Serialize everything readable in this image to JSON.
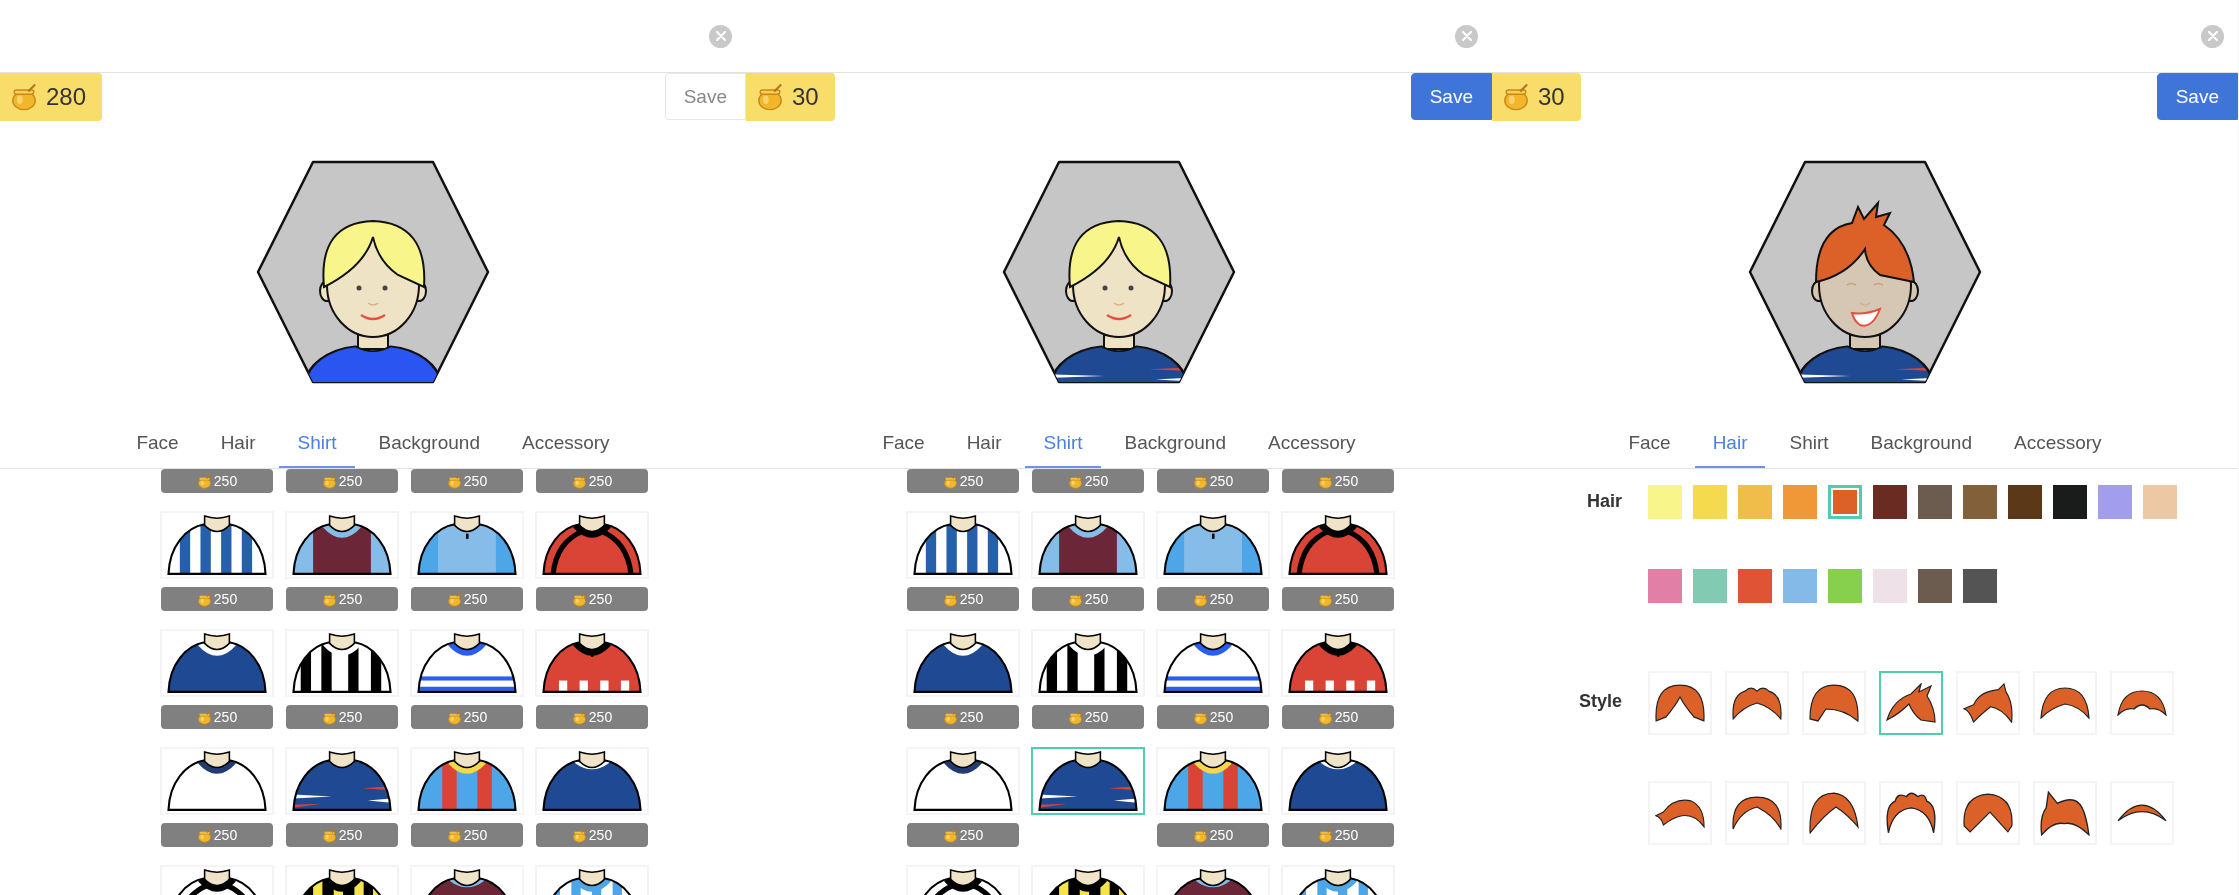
{
  "panels": [
    {
      "coins": "280",
      "save": {
        "label": "Save",
        "disabled": true
      },
      "tabs": [
        {
          "label": "Face",
          "selected": false
        },
        {
          "label": "Hair",
          "selected": false
        },
        {
          "label": "Shirt",
          "selected": true
        },
        {
          "label": "Background",
          "selected": false
        },
        {
          "label": "Accessory",
          "selected": false
        }
      ],
      "kind": "shirts",
      "shirts": [
        {
          "price": "250"
        },
        {
          "price": "250"
        },
        {
          "price": "250"
        },
        {
          "price": "250"
        },
        {
          "price": "250",
          "selected": false
        },
        {
          "price": "250",
          "selected": false
        },
        {
          "price": "250",
          "selected": false
        },
        {
          "price": "250",
          "selected": false
        },
        {
          "price": "250",
          "selected": false
        },
        {
          "price": "250",
          "selected": false
        },
        {
          "price": "250",
          "selected": false
        },
        {
          "price": "250",
          "selected": false
        },
        {
          "price": "250",
          "selected": false
        },
        {
          "price": "250",
          "selected": false
        },
        {
          "price": "250",
          "selected": false
        },
        {
          "price": "250",
          "selected": false
        },
        {
          "selected": false
        },
        {
          "selected": false
        },
        {
          "selected": false
        },
        {
          "selected": false
        }
      ]
    },
    {
      "coins": "30",
      "save": {
        "label": "Save",
        "disabled": false
      },
      "tabs": [
        {
          "label": "Face",
          "selected": false
        },
        {
          "label": "Hair",
          "selected": false
        },
        {
          "label": "Shirt",
          "selected": true
        },
        {
          "label": "Background",
          "selected": false
        },
        {
          "label": "Accessory",
          "selected": false
        }
      ],
      "kind": "shirts",
      "shirts": [
        {
          "price": "250"
        },
        {
          "price": "250"
        },
        {
          "price": "250"
        },
        {
          "price": "250"
        },
        {
          "price": "250",
          "selected": false
        },
        {
          "price": "250",
          "selected": false
        },
        {
          "price": "250",
          "selected": false
        },
        {
          "price": "250",
          "selected": false
        },
        {
          "price": "250",
          "selected": false
        },
        {
          "price": "250",
          "selected": false
        },
        {
          "price": "250",
          "selected": false
        },
        {
          "price": "250",
          "selected": false
        },
        {
          "price": "250",
          "selected": false
        },
        {
          "selected": true
        },
        {
          "price": "250",
          "selected": false
        },
        {
          "price": "250",
          "selected": false
        },
        {
          "selected": false
        },
        {
          "selected": false
        },
        {
          "selected": false
        },
        {
          "selected": false
        }
      ]
    },
    {
      "coins": "30",
      "save": {
        "label": "Save",
        "disabled": false
      },
      "tabs": [
        {
          "label": "Face",
          "selected": false
        },
        {
          "label": "Hair",
          "selected": true
        },
        {
          "label": "Shirt",
          "selected": false
        },
        {
          "label": "Background",
          "selected": false
        },
        {
          "label": "Accessory",
          "selected": false
        }
      ],
      "kind": "hair",
      "hair_label": "Hair",
      "style_label": "Style",
      "hair_colors": [
        {
          "color": "#f8f58a",
          "selected": false
        },
        {
          "color": "#f4da4c",
          "selected": false
        },
        {
          "color": "#f0bc4a",
          "selected": false
        },
        {
          "color": "#f09838",
          "selected": false
        },
        {
          "color": "#db6128",
          "selected": true
        },
        {
          "color": "#692b22",
          "selected": false
        },
        {
          "color": "#6c5c50",
          "selected": false
        },
        {
          "color": "#82603a",
          "selected": false
        },
        {
          "color": "#5a3818",
          "selected": false
        },
        {
          "color": "#1a1c1b",
          "selected": false
        },
        {
          "color": "#a39ded",
          "selected": false
        },
        {
          "color": "#ecc8a4",
          "selected": false
        },
        {
          "color": "#e27fa6",
          "selected": false
        },
        {
          "color": "#83cab2",
          "selected": false
        },
        {
          "color": "#e05436",
          "selected": false
        },
        {
          "color": "#84bae8",
          "selected": false
        },
        {
          "color": "#86d04e",
          "selected": false
        },
        {
          "color": "#eee2e8",
          "selected": false
        },
        {
          "color": "#6c5c50",
          "selected": false
        },
        {
          "color": "#545454",
          "selected": false
        }
      ],
      "hair_styles": [
        {
          "selected": false
        },
        {
          "selected": false
        },
        {
          "selected": false
        },
        {
          "selected": true
        },
        {
          "selected": false
        },
        {
          "selected": false
        },
        {
          "selected": false
        },
        {
          "selected": false
        },
        {
          "selected": false
        },
        {
          "selected": false
        },
        {
          "selected": false
        },
        {
          "selected": false
        },
        {
          "selected": false
        },
        {
          "selected": false
        }
      ]
    }
  ]
}
